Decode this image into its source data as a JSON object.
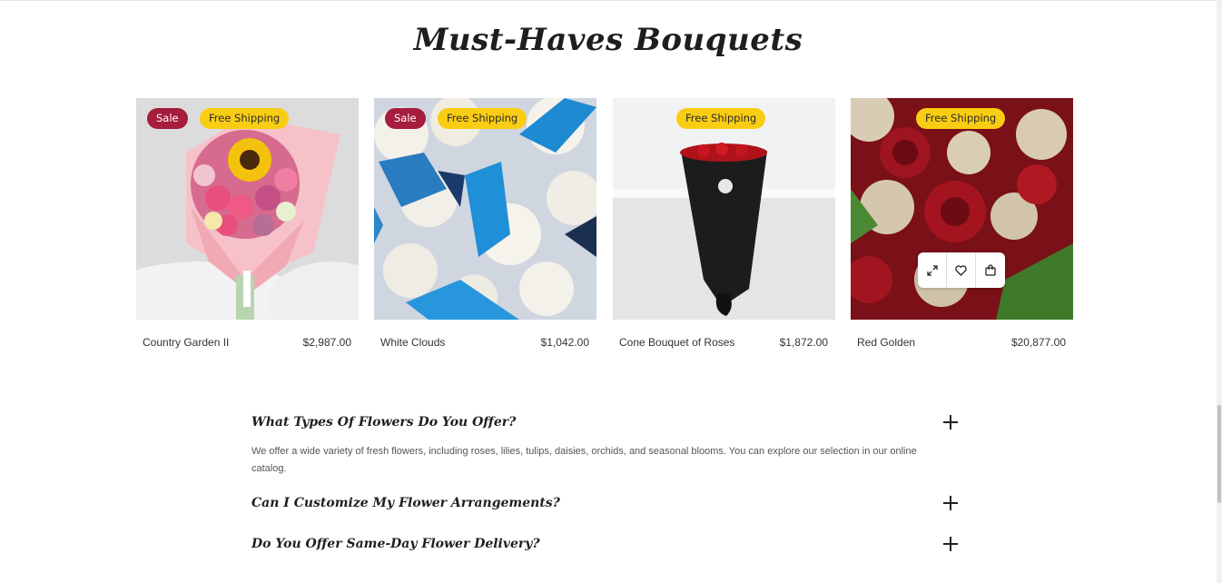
{
  "section": {
    "title": "Must-Haves Bouquets"
  },
  "products": [
    {
      "name": "Country Garden II",
      "price": "$2,987.00",
      "badges": [
        "Sale",
        "Free Shipping"
      ]
    },
    {
      "name": "White Clouds",
      "price": "$1,042.00",
      "badges": [
        "Sale",
        "Free Shipping"
      ]
    },
    {
      "name": "Cone Bouquet of Roses",
      "price": "$1,872.00",
      "badges": [
        "Free Shipping"
      ]
    },
    {
      "name": "Red Golden",
      "price": "$20,877.00",
      "badges": [
        "Free Shipping"
      ]
    }
  ],
  "hover_actions": [
    "expand-icon",
    "heart-icon",
    "cart-icon"
  ],
  "faq": [
    {
      "question": "What Types Of Flowers Do You Offer?",
      "answer": "We offer a wide variety of fresh flowers, including roses, lilies, tulips, daisies, orchids, and seasonal blooms. You can explore our selection in our online catalog."
    },
    {
      "question": "Can I Customize My Flower Arrangements?"
    },
    {
      "question": "Do You Offer Same-Day Flower Delivery?"
    }
  ],
  "colors": {
    "sale_badge": "#a61d3d",
    "shipping_badge": "#f9cd13"
  }
}
